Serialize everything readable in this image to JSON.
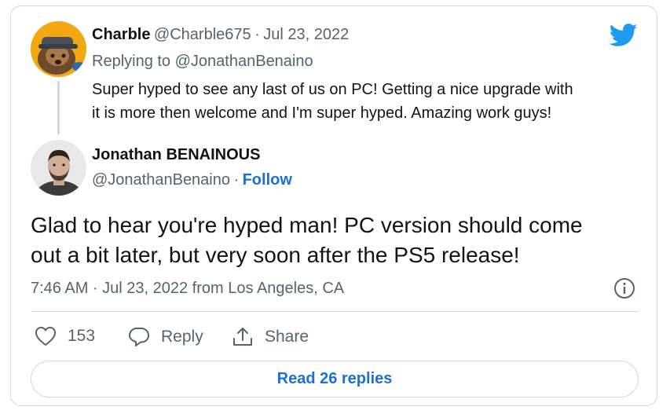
{
  "reply_tweet": {
    "author_name": "Charble",
    "author_handle": "@Charble675",
    "separator": "·",
    "date": "Jul 23, 2022",
    "replying_to_prefix": "Replying to ",
    "replying_to_handle": "@JonathanBenaino",
    "text_line1": "Super hyped to see any last of us on PC! Getting a nice upgrade with",
    "text_line2": "it is more then welcome and I'm super hyped. Amazing work guys!"
  },
  "main_tweet": {
    "author_name": "Jonathan BENAINOUS",
    "author_handle": "@JonathanBenaino",
    "separator": "·",
    "follow_label": "Follow",
    "text_line1": "Glad to hear you're hyped man! PC version should come",
    "text_line2": "out a bit later, but very soon after the PS5 release!",
    "timestamp": "7:46 AM · Jul 23, 2022 from Los Angeles, CA"
  },
  "actions": {
    "like_count": "153",
    "reply_label": "Reply",
    "share_label": "Share"
  },
  "read_replies_label": "Read 26 replies",
  "colors": {
    "accent": "#1d6fd8",
    "twitter_blue": "#1d9bf0",
    "muted": "#536471",
    "border": "#cfd9de"
  },
  "icons": [
    "twitter-bird-icon",
    "info-icon",
    "heart-icon",
    "reply-bubble-icon",
    "share-icon"
  ]
}
